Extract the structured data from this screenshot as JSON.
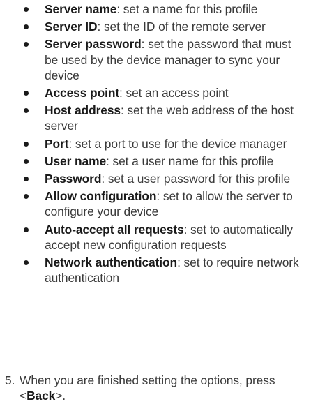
{
  "options": [
    {
      "term": "Server name",
      "desc": ": set a name for this profile"
    },
    {
      "term": "Server ID",
      "desc": ": set the ID of the remote server"
    },
    {
      "term": "Server password",
      "desc": ": set the password that must be used by the device manager to sync your device"
    },
    {
      "term": "Access point",
      "desc": ": set an access point"
    },
    {
      "term": "Host address",
      "desc": ": set the web address of the host server"
    },
    {
      "term": "Port",
      "desc": ": set a port to use for the device manager"
    },
    {
      "term": "User name",
      "desc": ": set a user name for this profile"
    },
    {
      "term": "Password",
      "desc": ": set a user password for this profile"
    },
    {
      "term": "Allow configuration",
      "desc": ": set to allow the server to configure your device"
    },
    {
      "term": "Auto-accept all requests",
      "desc": ": set to automatically accept new configuration requests"
    },
    {
      "term": "Network authentication",
      "desc": ": set to require network authentication"
    }
  ],
  "step5": {
    "number": "5.",
    "text_before": "When you are finished setting the options, press <",
    "key": "Back",
    "text_after": ">."
  }
}
